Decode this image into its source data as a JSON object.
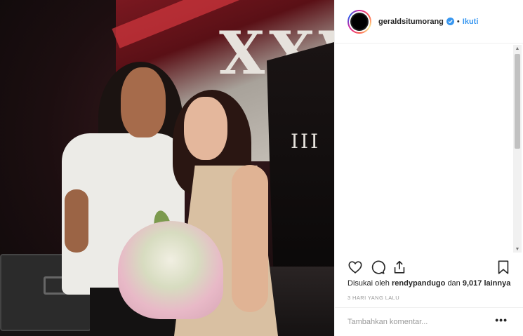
{
  "post": {
    "photo_alt": "",
    "stage_text": "XXV",
    "stage_text_small": "III"
  },
  "header": {
    "username": "geraldsitumorang",
    "separator": "•",
    "follow_label": "Ikuti"
  },
  "actions": {
    "icons": [
      "heart-icon",
      "comment-icon",
      "share-icon",
      "bookmark-icon"
    ]
  },
  "likes": {
    "prefix": "Disukai oleh",
    "user": "rendypandugo",
    "middle": "dan",
    "count": "9,017 lainnya"
  },
  "timestamp": "3 HARI YANG LALU",
  "comment": {
    "placeholder": "Tambahkan komentar...",
    "more_label": "•••"
  },
  "colors": {
    "link_blue": "#3897f0",
    "text": "#262626",
    "muted": "#999999"
  }
}
